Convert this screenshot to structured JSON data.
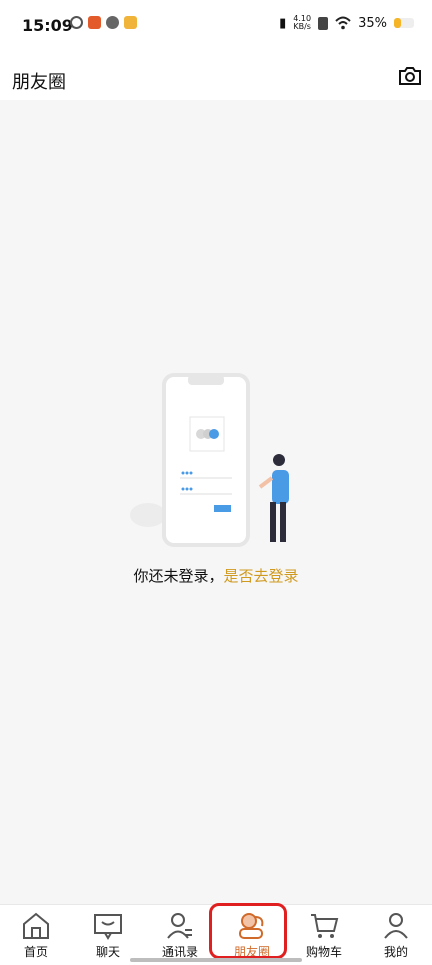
{
  "status_bar": {
    "time": "15:09",
    "net_speed_value": "4.10",
    "net_speed_unit": "KB/s",
    "battery_percent": "35%",
    "battery_level": 0.35
  },
  "header": {
    "title": "朋友圈"
  },
  "empty_state": {
    "message": "你还未登录，",
    "link_text": "是否去登录"
  },
  "tabs": [
    {
      "label": "首页",
      "icon": "home-icon",
      "active": false
    },
    {
      "label": "聊天",
      "icon": "chat-icon",
      "active": false
    },
    {
      "label": "通讯录",
      "icon": "contacts-icon",
      "active": false
    },
    {
      "label": "朋友圈",
      "icon": "moments-icon",
      "active": true
    },
    {
      "label": "购物车",
      "icon": "cart-icon",
      "active": false
    },
    {
      "label": "我的",
      "icon": "profile-icon",
      "active": false
    }
  ],
  "colors": {
    "accent": "#d06a2a",
    "link": "#d09a1f",
    "highlight_box": "#e02020"
  }
}
